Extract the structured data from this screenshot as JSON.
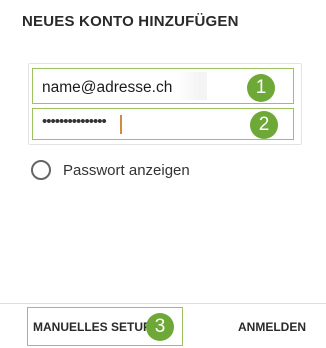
{
  "dialog": {
    "title": "NEUES KONTO HINZUFÜGEN"
  },
  "email_field": {
    "value": "name@adresse.ch"
  },
  "password_field": {
    "value": "•••••••••••••••"
  },
  "show_password": {
    "label": "Passwort anzeigen",
    "checked": false
  },
  "annotations": {
    "badge_1": "1",
    "badge_2": "2",
    "badge_3": "3"
  },
  "footer": {
    "manual_setup_label": "MANUELLES SETUP",
    "login_label": "ANMELDEN"
  },
  "colors": {
    "highlight": "#9bc25f",
    "badge": "#6ea837",
    "caret": "#d28a3e"
  }
}
